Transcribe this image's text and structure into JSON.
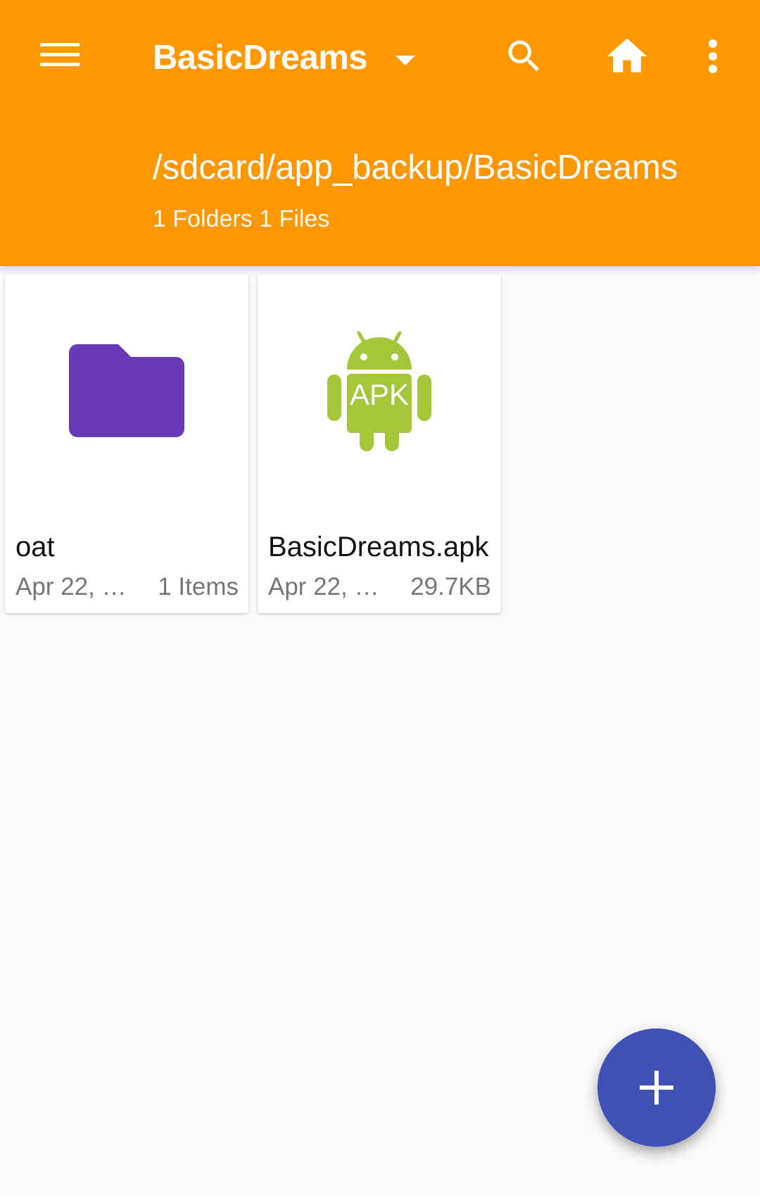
{
  "header": {
    "title": "BasicDreams",
    "path": "/sdcard/app_backup/BasicDreams",
    "summary": "1 Folders 1 Files",
    "background_color": "#FF9800"
  },
  "icons": {
    "menu": "menu-icon",
    "dropdown": "arrow-drop-down-icon",
    "search": "search-icon",
    "home": "home-icon",
    "more": "more-vert-icon",
    "folder": "folder-icon",
    "apk": "android-apk-icon",
    "fab": "add-icon"
  },
  "items": [
    {
      "name": "oat",
      "date": "Apr 22, 2…",
      "size": "1 Items",
      "type": "folder",
      "icon_color": "#673AB7"
    },
    {
      "name": "BasicDreams.apk",
      "date": "Apr 22, 20…",
      "size": "29.7KB",
      "type": "apk",
      "icon_color": "#A4C639"
    }
  ],
  "apk_icon_text": "APK",
  "fab": {
    "background_color": "#3F51B5"
  }
}
